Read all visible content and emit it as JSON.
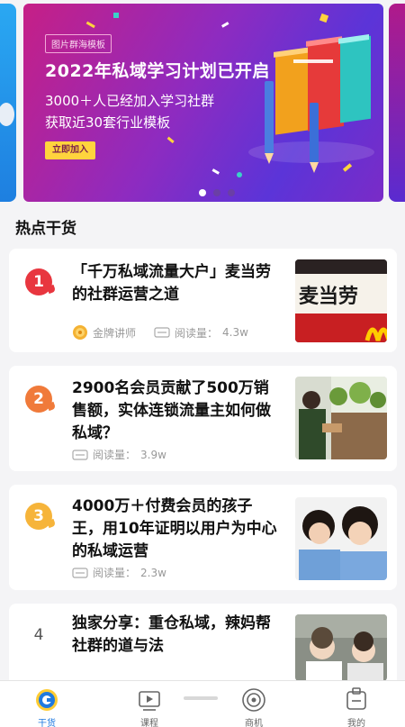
{
  "banner": {
    "tag": "图片群海模板",
    "title": "2022年私域学习计划已开启",
    "subtitle_line1": "3000＋人已经加入学习社群",
    "subtitle_line2": "获取近30套行业模板",
    "join_button": "立即加入",
    "active_dot": 1,
    "total_dots": 3
  },
  "section": {
    "title": "热点干货"
  },
  "articles": [
    {
      "rank": "1",
      "rank_color": "#e8363f",
      "title": "「千万私域流量大户」麦当劳的社群运营之道",
      "author_badge": "金牌讲师",
      "reads_label": "阅读量：",
      "reads": "4.3w"
    },
    {
      "rank": "2",
      "rank_color": "#f07a3a",
      "title": "2900名会员贡献了500万销售额，实体连锁流量主如何做私域？",
      "reads_label": "阅读量：",
      "reads": "3.9w"
    },
    {
      "rank": "3",
      "rank_color": "#f6b43a",
      "title": "4000万＋付费会员的孩子王，用10年证明以用户为中心的私域运营",
      "reads_label": "阅读量：",
      "reads": "2.3w"
    },
    {
      "rank": "4",
      "rank_color": "",
      "title": "独家分享：重仓私域，辣妈帮社群的道与法"
    }
  ],
  "thumb1_text": "麦当劳",
  "tabs": [
    {
      "label": "干货",
      "icon": "dry-goods-icon",
      "active": true
    },
    {
      "label": "课程",
      "icon": "video-course-icon",
      "active": false
    },
    {
      "label": "商机",
      "icon": "opportunity-icon",
      "active": false
    },
    {
      "label": "我的",
      "icon": "profile-icon",
      "active": false
    }
  ],
  "colors": {
    "accent": "#1f7ae0",
    "banner_gradient_start": "#c61f86",
    "banner_gradient_end": "#5b34d8"
  }
}
